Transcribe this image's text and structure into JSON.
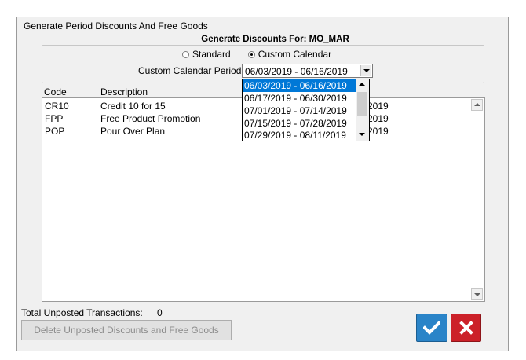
{
  "window": {
    "title": "Generate Period Discounts And Free Goods",
    "heading": "Generate Discounts For:  MO_MAR"
  },
  "options": {
    "standard_label": "Standard",
    "custom_label": "Custom Calendar",
    "selected": "Custom Calendar",
    "period_label": "Custom Calendar Period",
    "period_value": "06/03/2019 - 06/16/2019"
  },
  "dropdown": {
    "items": [
      "06/03/2019 - 06/16/2019",
      "06/17/2019 - 06/30/2019",
      "07/01/2019 - 07/14/2019",
      "07/15/2019 - 07/28/2019",
      "07/29/2019 - 08/11/2019"
    ],
    "selected_index": 0
  },
  "table": {
    "columns": {
      "code": "Code",
      "description": "Description"
    },
    "rows": [
      {
        "code": "CR10",
        "description": "Credit 10 for 15",
        "date_tail": "2019"
      },
      {
        "code": "FPP",
        "description": "Free Product Promotion",
        "date_tail": "2019"
      },
      {
        "code": "POP",
        "description": "Pour Over Plan",
        "date_tail": "2019"
      }
    ]
  },
  "footer": {
    "total_label": "Total Unposted Transactions:",
    "total_value": "0",
    "delete_label": "Delete Unposted Discounts and Free Goods"
  },
  "colors": {
    "ok": "#2a84c8",
    "cancel": "#cc2129",
    "selection": "#0078d7"
  }
}
